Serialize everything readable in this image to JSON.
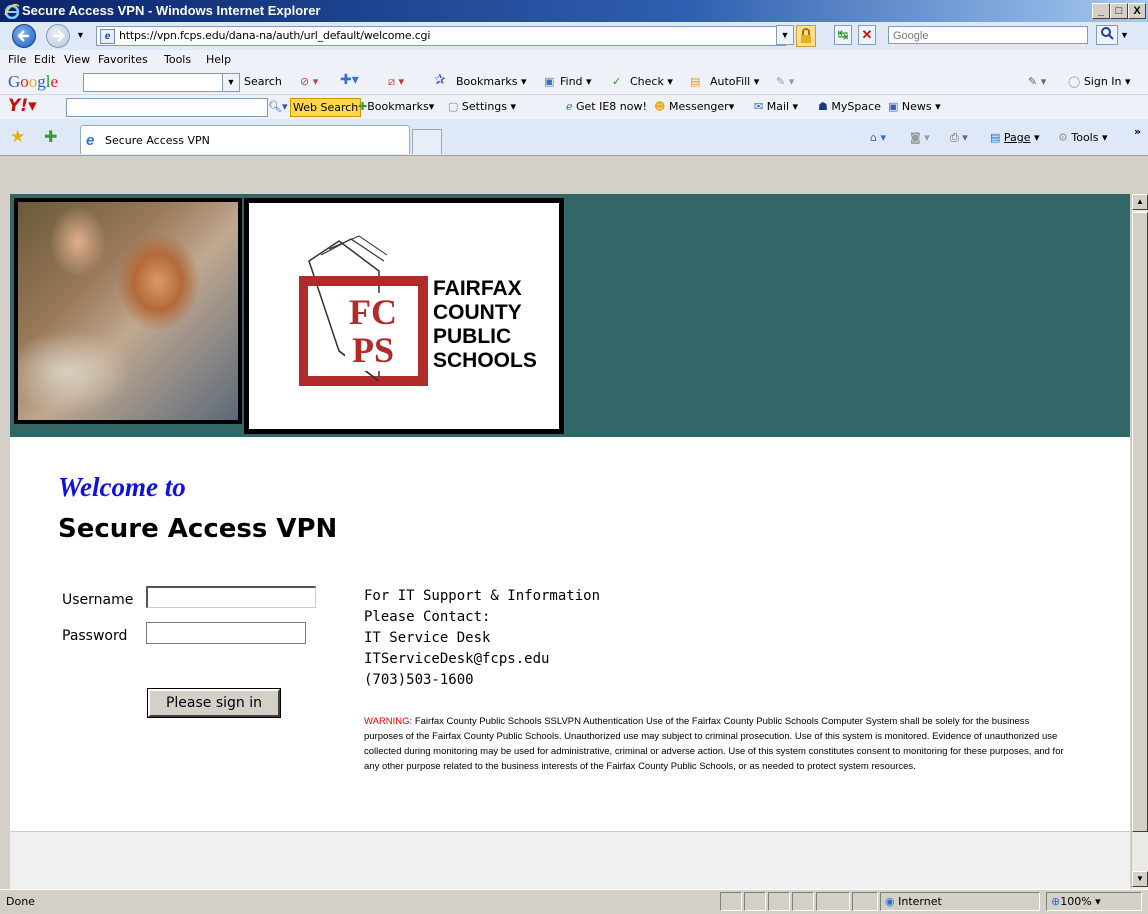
{
  "window": {
    "title": "Secure Access VPN - Windows Internet Explorer",
    "controls": {
      "minimize": "_",
      "maximize": "□",
      "close": "X"
    }
  },
  "address_bar": {
    "url": "https://vpn.fcps.edu/dana-na/auth/url_default/welcome.cgi",
    "search_placeholder": "Google"
  },
  "menu": [
    "File",
    "Edit",
    "View",
    "Favorites",
    "Tools",
    "Help"
  ],
  "google_toolbar": {
    "brand": "Google",
    "search_label": "Search",
    "bookmarks_label": "Bookmarks",
    "find_label": "Find",
    "check_label": "Check",
    "autofill_label": "AutoFill",
    "signin_label": "Sign In"
  },
  "yahoo_toolbar": {
    "web_search_label": "Web Search",
    "bookmarks_label": "Bookmarks",
    "settings_label": "Settings",
    "ie8_label": "Get IE8 now!",
    "messenger_label": "Messenger",
    "mail_label": "Mail",
    "myspace_label": "MySpace",
    "news_label": "News"
  },
  "tabs": {
    "active_title": "Secure Access VPN",
    "page_label": "Page",
    "tools_label": "Tools"
  },
  "page": {
    "logo": {
      "letters_top": "FC",
      "letters_bottom": "PS",
      "line1": "FAIRFAX",
      "line2": "COUNTY",
      "line3": "PUBLIC",
      "line4": "SCHOOLS"
    },
    "welcome": "Welcome to",
    "title": "Secure Access VPN",
    "form": {
      "username_label": "Username",
      "password_label": "Password",
      "username_value": "",
      "password_value": "",
      "submit_label": "Please sign in"
    },
    "support": {
      "line1": "For IT Support & Information",
      "line2": "Please Contact:",
      "line3": "IT Service Desk",
      "line4": "ITServiceDesk@fcps.edu",
      "line5": "(703)503-1600"
    },
    "warning": {
      "label": "WARNING:",
      "text": " Fairfax County Public Schools SSLVPN Authentication Use of the Fairfax County Public Schools Computer System shall be solely for the business purposes of the Fairfax County Public Schools. Unauthorized use may subject to criminal prosecution. Use of this system is monitored. Evidence of unauthorized use collected during monitoring may be used for administrative, criminal or adverse action. Use of this system constitutes consent to monitoring for these purposes, and for any other purpose related to the business interests of the Fairfax County Public Schools, or as needed to protect system resources."
    }
  },
  "status_bar": {
    "status": "Done",
    "zone": "Internet",
    "zoom": "100%"
  },
  "colors": {
    "banner": "#336666",
    "logo_red": "#b22a2a",
    "welcome_blue": "#1111dd",
    "warning_red": "#ee0000"
  }
}
